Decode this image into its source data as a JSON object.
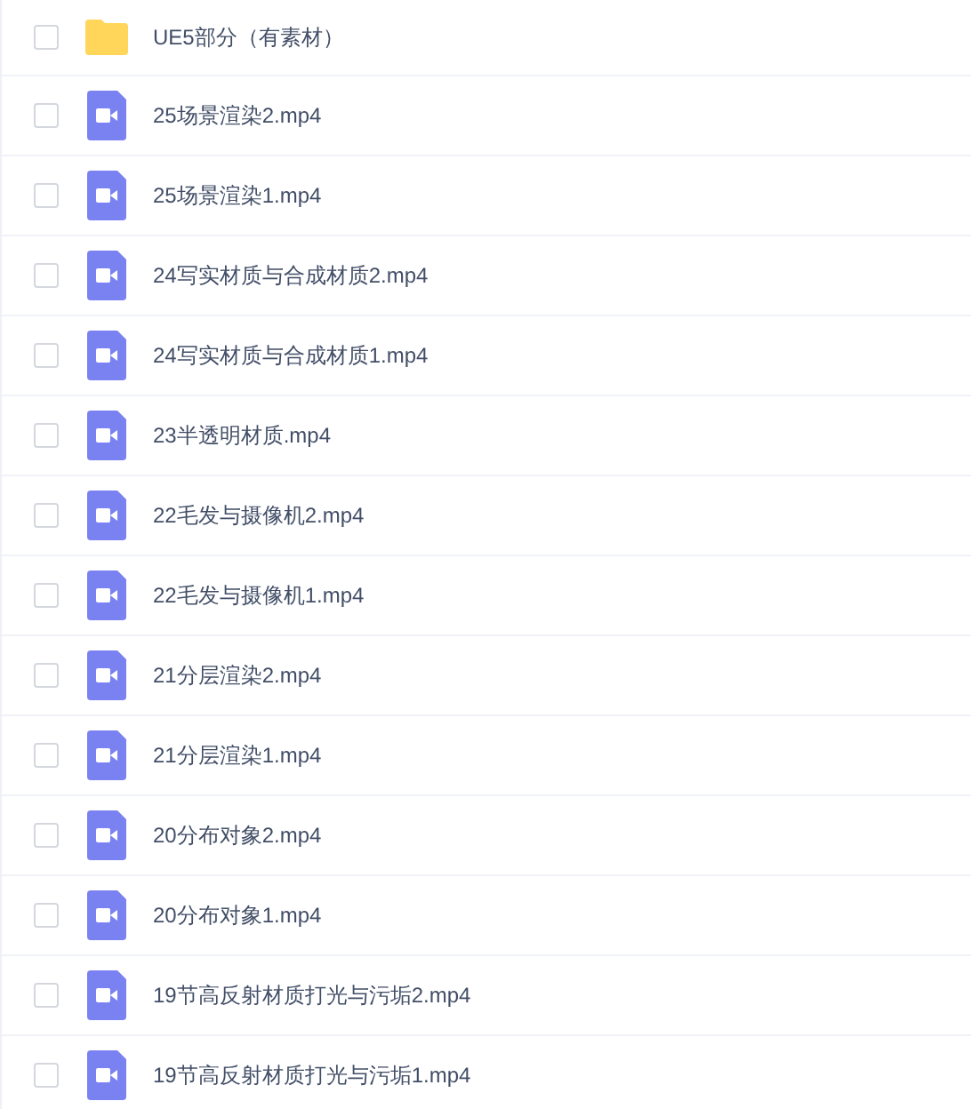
{
  "files": [
    {
      "kind": "folder",
      "name": "UE5部分（有素材）",
      "checked": false
    },
    {
      "kind": "video",
      "name": "25场景渲染2.mp4",
      "checked": false
    },
    {
      "kind": "video",
      "name": "25场景渲染1.mp4",
      "checked": false
    },
    {
      "kind": "video",
      "name": "24写实材质与合成材质2.mp4",
      "checked": false
    },
    {
      "kind": "video",
      "name": "24写实材质与合成材质1.mp4",
      "checked": false
    },
    {
      "kind": "video",
      "name": "23半透明材质.mp4",
      "checked": false
    },
    {
      "kind": "video",
      "name": "22毛发与摄像机2.mp4",
      "checked": false
    },
    {
      "kind": "video",
      "name": "22毛发与摄像机1.mp4",
      "checked": false
    },
    {
      "kind": "video",
      "name": "21分层渲染2.mp4",
      "checked": false
    },
    {
      "kind": "video",
      "name": "21分层渲染1.mp4",
      "checked": false
    },
    {
      "kind": "video",
      "name": "20分布对象2.mp4",
      "checked": false
    },
    {
      "kind": "video",
      "name": "20分布对象1.mp4",
      "checked": false
    },
    {
      "kind": "video",
      "name": "19节高反射材质打光与污垢2.mp4",
      "checked": false
    },
    {
      "kind": "video",
      "name": "19节高反射材质打光与污垢1.mp4",
      "checked": false
    }
  ]
}
